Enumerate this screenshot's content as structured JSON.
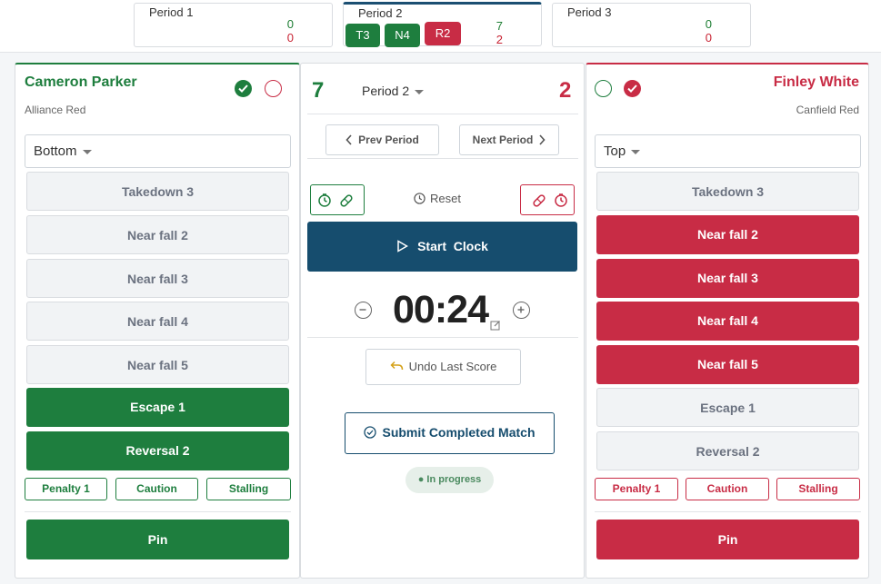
{
  "periods": [
    {
      "name": "Period 1",
      "green_score": "0",
      "red_score": "0"
    },
    {
      "name": "Period 2",
      "green_score": "7",
      "red_score": "2",
      "chips": [
        "T3",
        "N4",
        "R2"
      ]
    },
    {
      "name": "Period 3",
      "green_score": "0",
      "red_score": "0"
    }
  ],
  "left": {
    "name": "Cameron Parker",
    "team": "Alliance Red",
    "position": "Bottom",
    "moves": [
      "Takedown 3",
      "Near fall 2",
      "Near fall 3",
      "Near fall 4",
      "Near fall 5",
      "Escape 1",
      "Reversal 2"
    ],
    "penalty": "Penalty 1",
    "caution": "Caution",
    "stalling": "Stalling",
    "pin": "Pin"
  },
  "right": {
    "name": "Finley White",
    "team": "Canfield Red",
    "position": "Top",
    "moves": [
      "Takedown 3",
      "Near fall 2",
      "Near fall 3",
      "Near fall 4",
      "Near fall 5",
      "Escape 1",
      "Reversal 2"
    ],
    "penalty": "Penalty 1",
    "caution": "Caution",
    "stalling": "Stalling",
    "pin": "Pin"
  },
  "center": {
    "green_score": "7",
    "red_score": "2",
    "period": "Period 2",
    "prev": "Prev Period",
    "next": "Next Period",
    "reset": "Reset",
    "start_clock": "Start  Clock",
    "timer": "00:24",
    "undo": "Undo Last Score",
    "submit": "Submit Completed Match",
    "status": "● In progress"
  },
  "colors": {
    "green": "#1e7e3e",
    "red": "#c82c45",
    "navy": "#164d6e"
  }
}
